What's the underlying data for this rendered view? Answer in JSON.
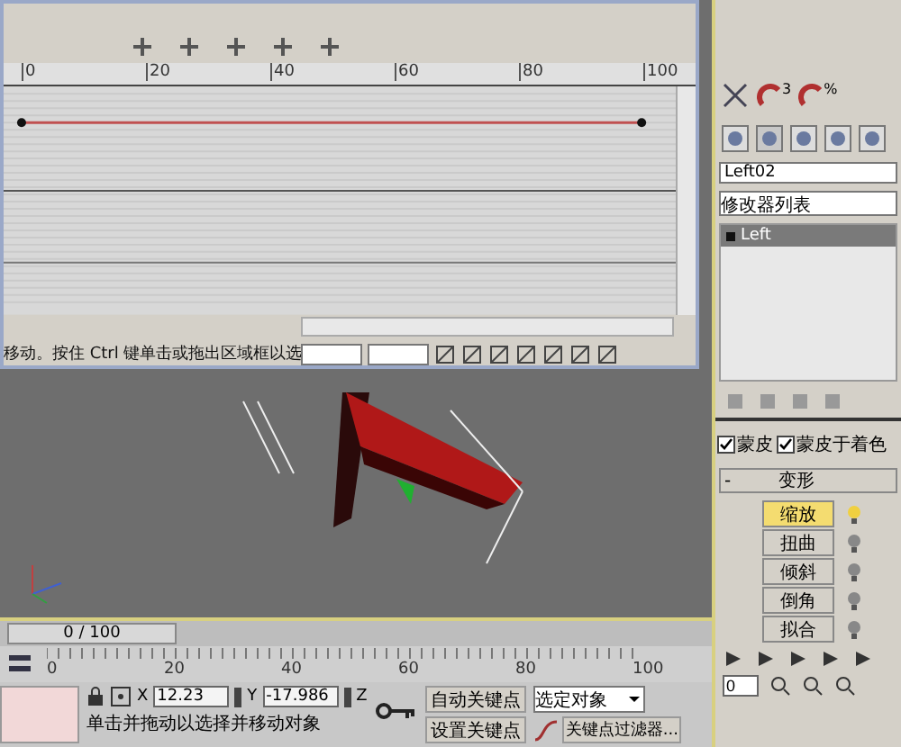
{
  "curve_editor": {
    "ruler": [
      "0",
      "20",
      "40",
      "60",
      "80",
      "100"
    ],
    "status_text": "移动。按住 Ctrl 键单击或拖出区域框以选"
  },
  "time_slider": {
    "label": "0 / 100"
  },
  "timeline": {
    "ticks": [
      "0",
      "20",
      "40",
      "60",
      "80",
      "100"
    ]
  },
  "coordinates": {
    "x_label": "X",
    "x_value": "12.23",
    "y_label": "Y",
    "y_value": "-17.986",
    "z_label": "Z"
  },
  "auto_key": {
    "label": "自动关键点",
    "on": false
  },
  "set_key": "设置关键点",
  "selection_dropdown": "选定对象",
  "key_filters": "关键点过滤器...",
  "frame_field": "0",
  "status_prompt": "单击并拖动以选择并移动对象",
  "modify_panel": {
    "snap_badges": [
      "3",
      "%"
    ],
    "object_name": "Left02",
    "modifier_list": "修改器列表",
    "stack": [
      {
        "label": "Left",
        "selected": true
      }
    ],
    "checkboxes": [
      {
        "label": "蒙皮",
        "checked": true
      },
      {
        "label": "蒙皮于着色",
        "checked": true
      }
    ],
    "rollout": {
      "sign": "-",
      "title": "变形"
    },
    "deformations": [
      {
        "label": "缩放",
        "selected": true
      },
      {
        "label": "扭曲",
        "selected": false
      },
      {
        "label": "倾斜",
        "selected": false
      },
      {
        "label": "倒角",
        "selected": false
      },
      {
        "label": "拟合",
        "selected": false
      }
    ]
  }
}
